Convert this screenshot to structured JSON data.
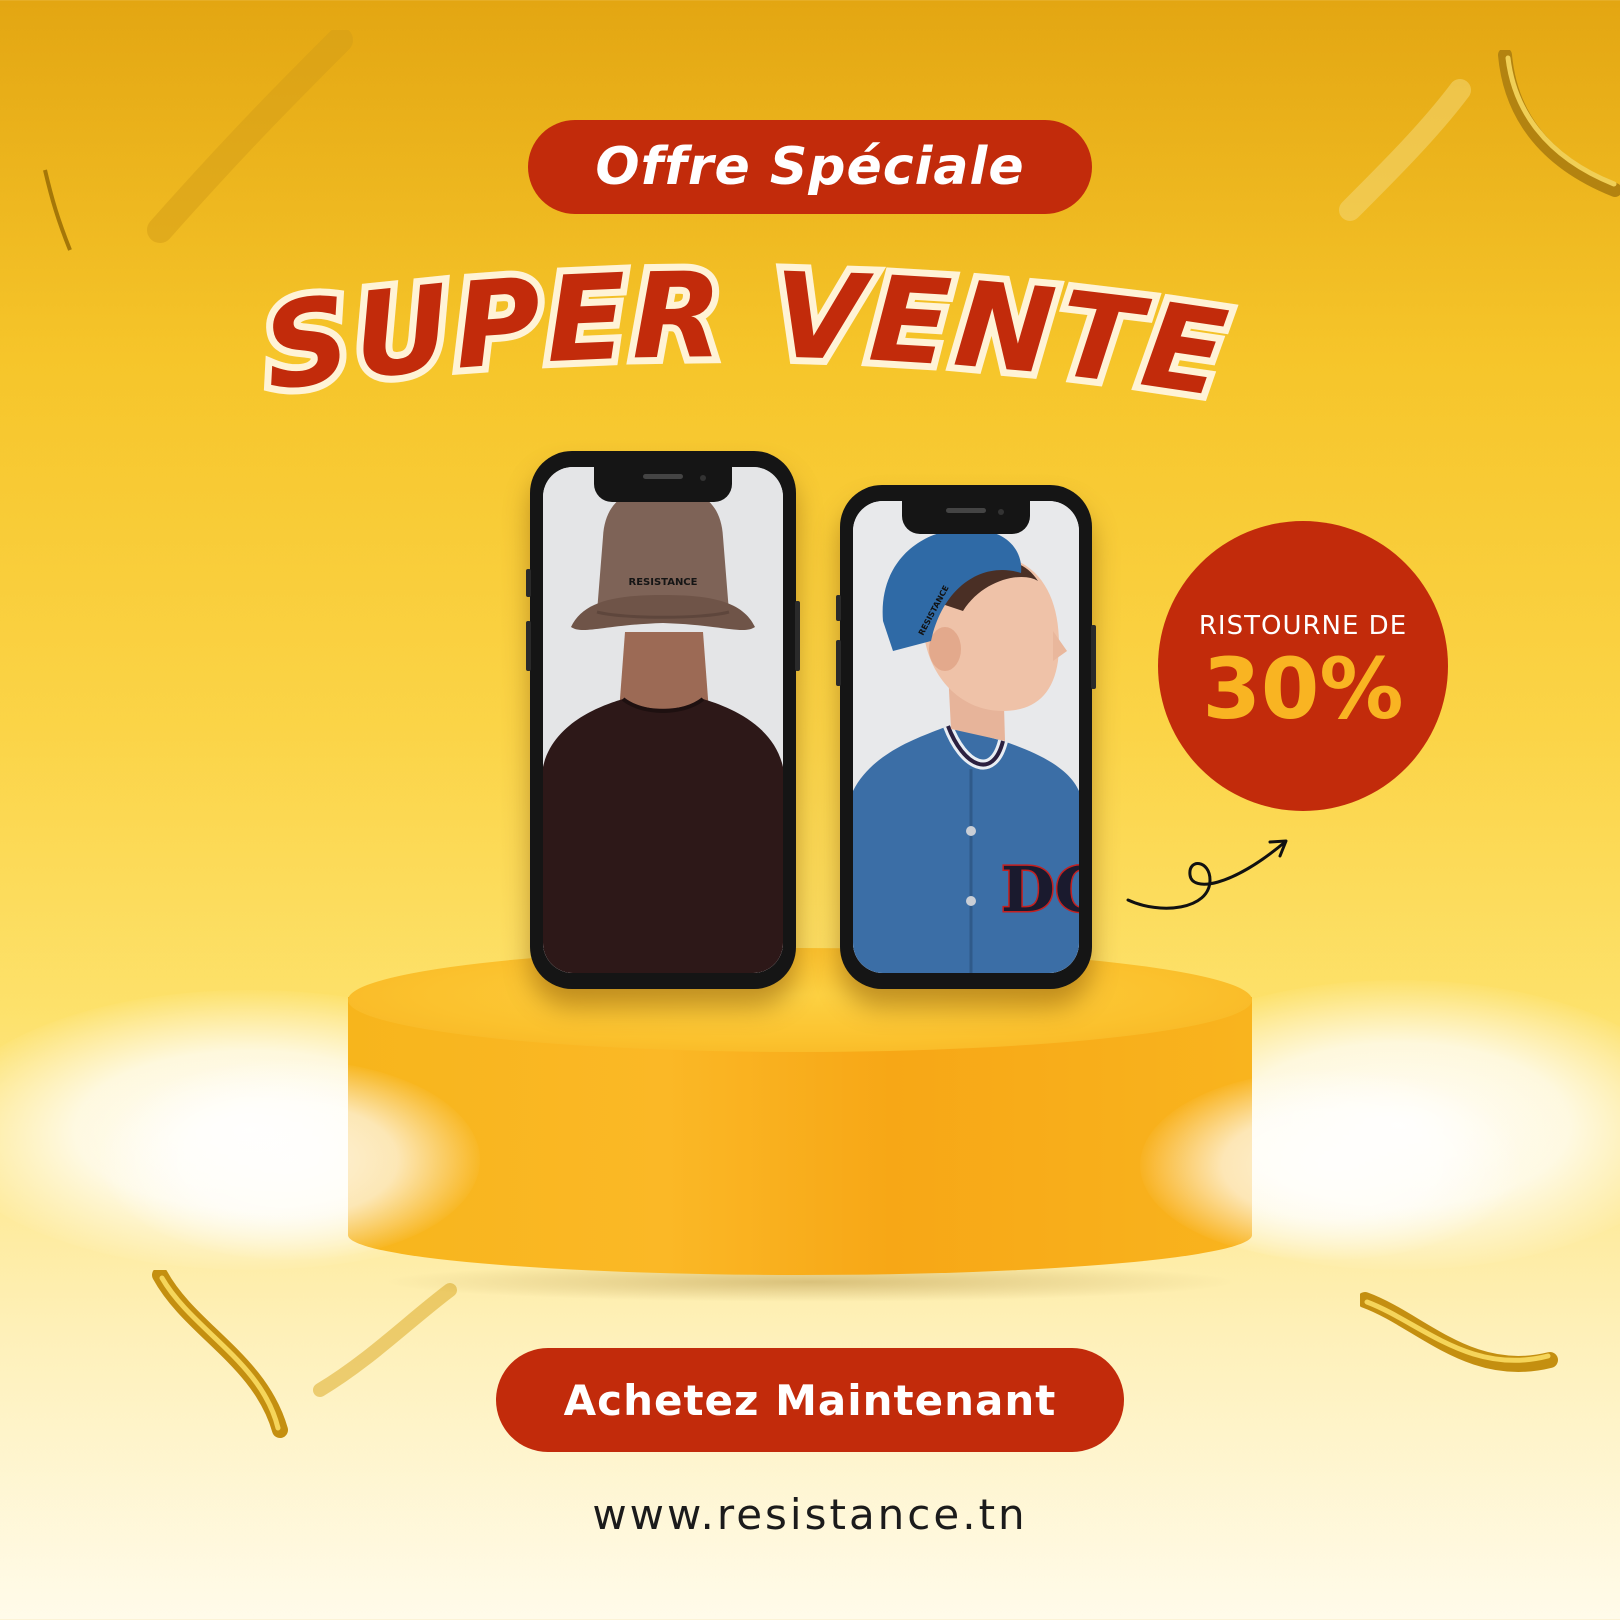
{
  "offer_pill": {
    "label": "Offre Spéciale"
  },
  "headline": {
    "text": "SUPER VENTE"
  },
  "products": [
    {
      "name": "bucket-hat-photo",
      "hat_logo": "RESISTANCE"
    },
    {
      "name": "denim-beanie-photo",
      "hat_logo": "RESISTANCE",
      "jacket_letters": "DC"
    }
  ],
  "discount": {
    "label": "RISTOURNE DE",
    "value": "30%"
  },
  "cta": {
    "label": "Achetez Maintenant"
  },
  "website": {
    "url": "www.resistance.tn"
  },
  "colors": {
    "primary_red": "#c22b0b",
    "accent_orange": "#f9b422",
    "background_yellow": "#fbd447",
    "gold": "#c99a1c"
  }
}
